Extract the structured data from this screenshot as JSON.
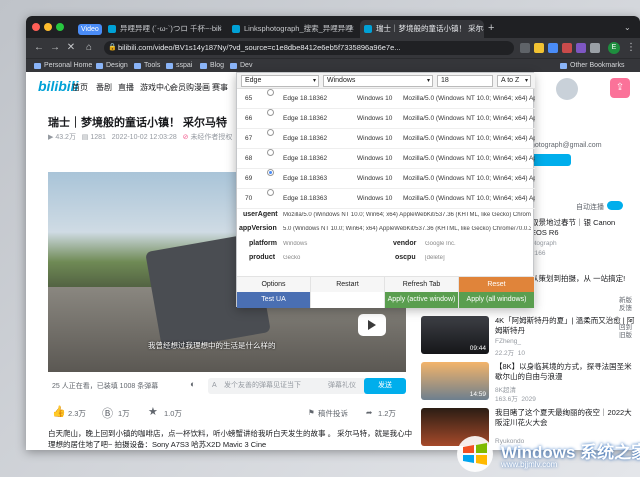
{
  "colors": {
    "accent": "#00a1d6",
    "send": "#00aeec",
    "tab_active": "#35363a",
    "red_btn": "#f08c36",
    "green_btn": "#5a9e4f",
    "blue_btn": "#4a6fb3"
  },
  "browser": {
    "video_badge": "Video",
    "tabs": [
      {
        "title": "异哩异哩 (´-ω-`)つロ 千杯~-bili"
      },
      {
        "title": "Linksphotograph_搜索_异哩异哩"
      },
      {
        "title": "瑞士｜梦境般的童话小镇！ 采尔马"
      }
    ],
    "new_tab_icon": "plus-icon",
    "url": "bilibili.com/video/BV1s14y187Ny/?vd_source=c1e8dbe8412e6eb5f7335896a96e7e...",
    "profile_letter": "E",
    "bookmarks": [
      "Personal Home",
      "Design",
      "Tools",
      "sspai",
      "Blog",
      "Dev"
    ],
    "other_bookmarks": "Other Bookmarks"
  },
  "site": {
    "logo": "bilibili",
    "nav": [
      "首页",
      "番剧",
      "直播",
      "游戏中心",
      "会员购",
      "漫画",
      "赛事"
    ],
    "video_title": "瑞士｜梦境般的童话小镇！ 采尔马特",
    "meta": {
      "views": "43.2万",
      "danmaku": "1281",
      "date": "2022-10-02 12:03:28",
      "notice": "未经作者授权"
    },
    "subtitle": "我曾经想过我理想中的生活是什么样的",
    "danmu": {
      "watching": "25 人正在看，已装填 1008 条弹幕",
      "placeholder": "发个友善的弹幕见证当下",
      "etiquette": "弹幕礼仪",
      "send": "发送"
    },
    "actions": {
      "like": "2.3万",
      "coin": "1万",
      "fav": "1.0万",
      "report": "稿件投诉",
      "share": "1.2万"
    },
    "description": "白天爬山，晚上回到小镇的咖啡店，点一杯饮料，听小螃蟹讲给我听白天发生的故事 。 采尔马特，就是我心中理想的居住地了吧~  拍摄设备：Sony A7S3 哈苏X2D Mavic 3 Cine"
  },
  "sidebar": {
    "email_fragment": "hotograph@gmail.com",
    "autoplay": "自动连播",
    "rec_top": [
      {
        "title": "取景地过春节｜银 Canon EOS R6",
        "user": "otograph",
        "views": "2166"
      },
      {
        "title": "从策划到拍摄，从 一站搞定!",
        "user": ""
      }
    ],
    "side_links": [
      "新版",
      "反馈",
      "回到",
      "旧版"
    ],
    "recs": [
      {
        "title": "4K「阿姆斯特丹的夏」| 溫柔而又治愈 | 阿姆斯特丹",
        "user": "FZheng_",
        "views": "22.2万",
        "stat": "10",
        "duration": "09:44"
      },
      {
        "title": "【8K】以身临其境的方式，探寻法国圣米歇尔山的自由与浪漫",
        "user": "8K超清",
        "views": "163.6万",
        "stat": "2029",
        "duration": "14:59"
      },
      {
        "title": "我目睹了这个夏天最绚丽的夜空｜2022大阪淀川花火大会",
        "user": "Ryukondo",
        "views": "",
        "stat": "",
        "duration": ""
      }
    ]
  },
  "ua_switcher": {
    "filters": {
      "browser": "Edge",
      "os": "Windows",
      "search": "18",
      "sort": "A to Z"
    },
    "rows": [
      {
        "id": "65",
        "browser": "Edge 18.18362",
        "os": "Windows 10",
        "ua": "Mozilla/5.0 (Windows NT 10.0; Win64; x64) Appl...",
        "selected": false
      },
      {
        "id": "66",
        "browser": "Edge 18.18362",
        "os": "Windows 10",
        "ua": "Mozilla/5.0 (Windows NT 10.0; Win64; x64) Appl...",
        "selected": false
      },
      {
        "id": "67",
        "browser": "Edge 18.18362",
        "os": "Windows 10",
        "ua": "Mozilla/5.0 (Windows NT 10.0; Win64; x64) Appl...",
        "selected": false
      },
      {
        "id": "68",
        "browser": "Edge 18.18362",
        "os": "Windows 10",
        "ua": "Mozilla/5.0 (Windows NT 10.0; Win64; x64) Appl...",
        "selected": false
      },
      {
        "id": "69",
        "browser": "Edge 18.18363",
        "os": "Windows 10",
        "ua": "Mozilla/5.0 (Windows NT 10.0; Win64; x64) Appl...",
        "selected": true
      },
      {
        "id": "70",
        "browser": "Edge 18.18363",
        "os": "Windows 10",
        "ua": "Mozilla/5.0 (Windows NT 10.0; Win64; x64) Appl...",
        "selected": false
      }
    ],
    "details": {
      "userAgent_label": "userAgent",
      "userAgent": "Mozilla/5.0 (Windows NT 10.0; Win64; x64) AppleWebKit/537.36 (KHTML, like Gecko) Chrome/70.0.3538",
      "appVersion_label": "appVersion",
      "appVersion": "5.0 (Windows NT 10.0; Win64; x64) AppleWebKit/537.36 (KHTML, like Gecko) Chrome/70.0.3538.102 Sa",
      "platform_label": "platform",
      "platform": "Windows",
      "vendor_label": "vendor",
      "vendor": "Google Inc.",
      "product_label": "product",
      "product": "Gecko",
      "oscpu_label": "oscpu",
      "oscpu": "[delete]"
    },
    "buttons": {
      "options": "Options",
      "restart": "Restart",
      "refresh": "Refresh Tab",
      "reset": "Reset",
      "test": "Test UA",
      "apply_active": "Apply (active window)",
      "apply_all": "Apply (all windows)"
    }
  },
  "watermark": {
    "brand": "Windows",
    "cn": "系统之家",
    "url": "www.bjjmlv.com"
  }
}
